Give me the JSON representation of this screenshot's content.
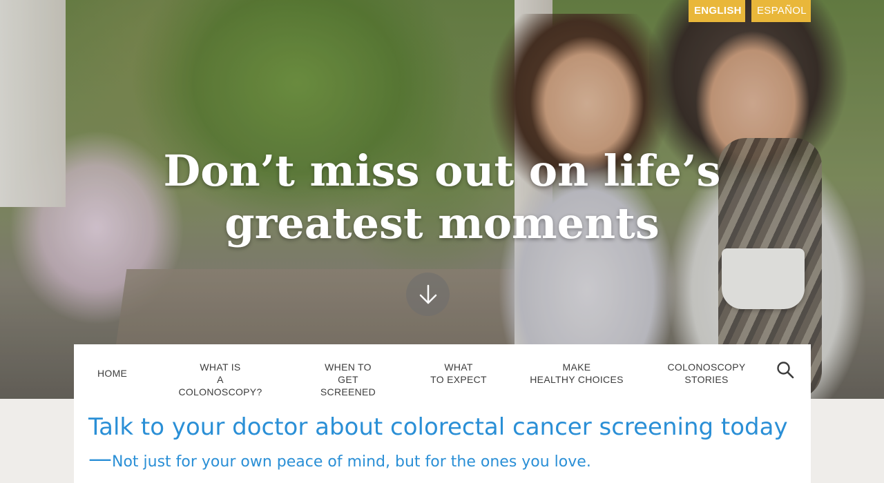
{
  "language": {
    "english": "ENGLISH",
    "spanish": "ESPAÑOL"
  },
  "hero": {
    "headline_line1": "Don’t miss out on life’s",
    "headline_line2": "greatest moments",
    "scroll_icon": "arrow-down-icon"
  },
  "nav": {
    "home": "HOME",
    "colonoscopy_l1": "WHAT IS",
    "colonoscopy_l2": "A COLONOSCOPY?",
    "screened_l1": "WHEN TO",
    "screened_l2": "GET SCREENED",
    "expect_l1": "WHAT",
    "expect_l2": "TO EXPECT",
    "choices_l1": "MAKE",
    "choices_l2": "HEALTHY CHOICES",
    "stories_l1": "COLONOSCOPY",
    "stories_l2": "STORIES",
    "search_icon": "search-icon"
  },
  "content": {
    "tagline_main": "Talk to your doctor about colorectal cancer screening today—",
    "tagline_sub": "Not just for your own peace of mind, but for the ones you love."
  },
  "colors": {
    "accent_blue": "#2a8fd6",
    "lang_yellow": "#e9b73a"
  }
}
